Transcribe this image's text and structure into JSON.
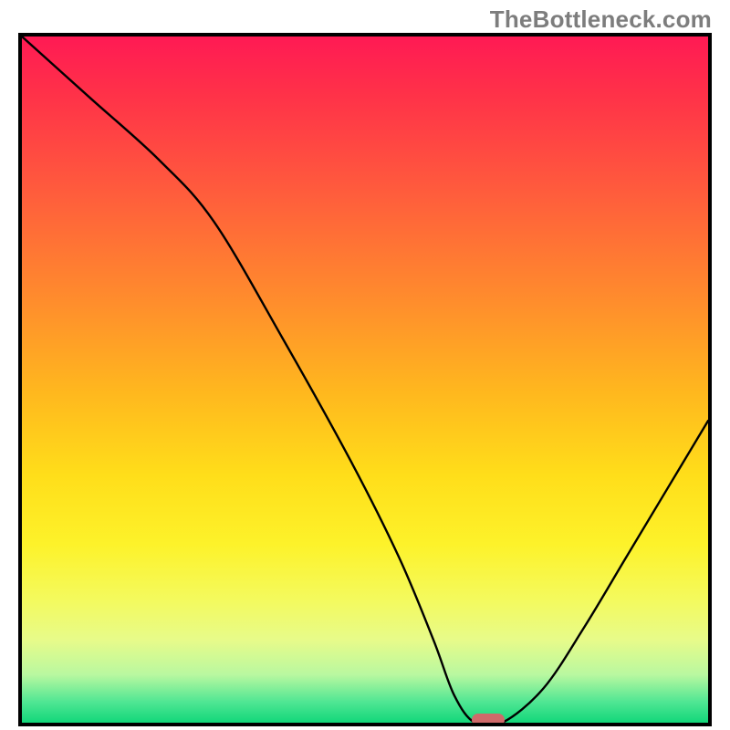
{
  "watermark": "TheBottleneck.com",
  "colors": {
    "border": "#000000",
    "curve": "#000000",
    "marker": "#cf6a6a",
    "gradient_top": "#ff1a54",
    "gradient_mid": "#ffde1a",
    "gradient_bottom": "#12d77a"
  },
  "chart_data": {
    "type": "line",
    "title": "",
    "xlabel": "",
    "ylabel": "",
    "xlim": [
      0,
      100
    ],
    "ylim": [
      0,
      100
    ],
    "x": [
      0,
      10,
      20,
      28,
      38,
      48,
      55,
      60,
      63,
      66,
      70,
      76,
      82,
      88,
      94,
      100
    ],
    "values": [
      100,
      91,
      82,
      73,
      56,
      38,
      24,
      12,
      4,
      0,
      0,
      5,
      14,
      24,
      34,
      44
    ],
    "minimum_x": 68,
    "minimum_y": 0,
    "marker": {
      "x": 68,
      "y": 0
    }
  }
}
